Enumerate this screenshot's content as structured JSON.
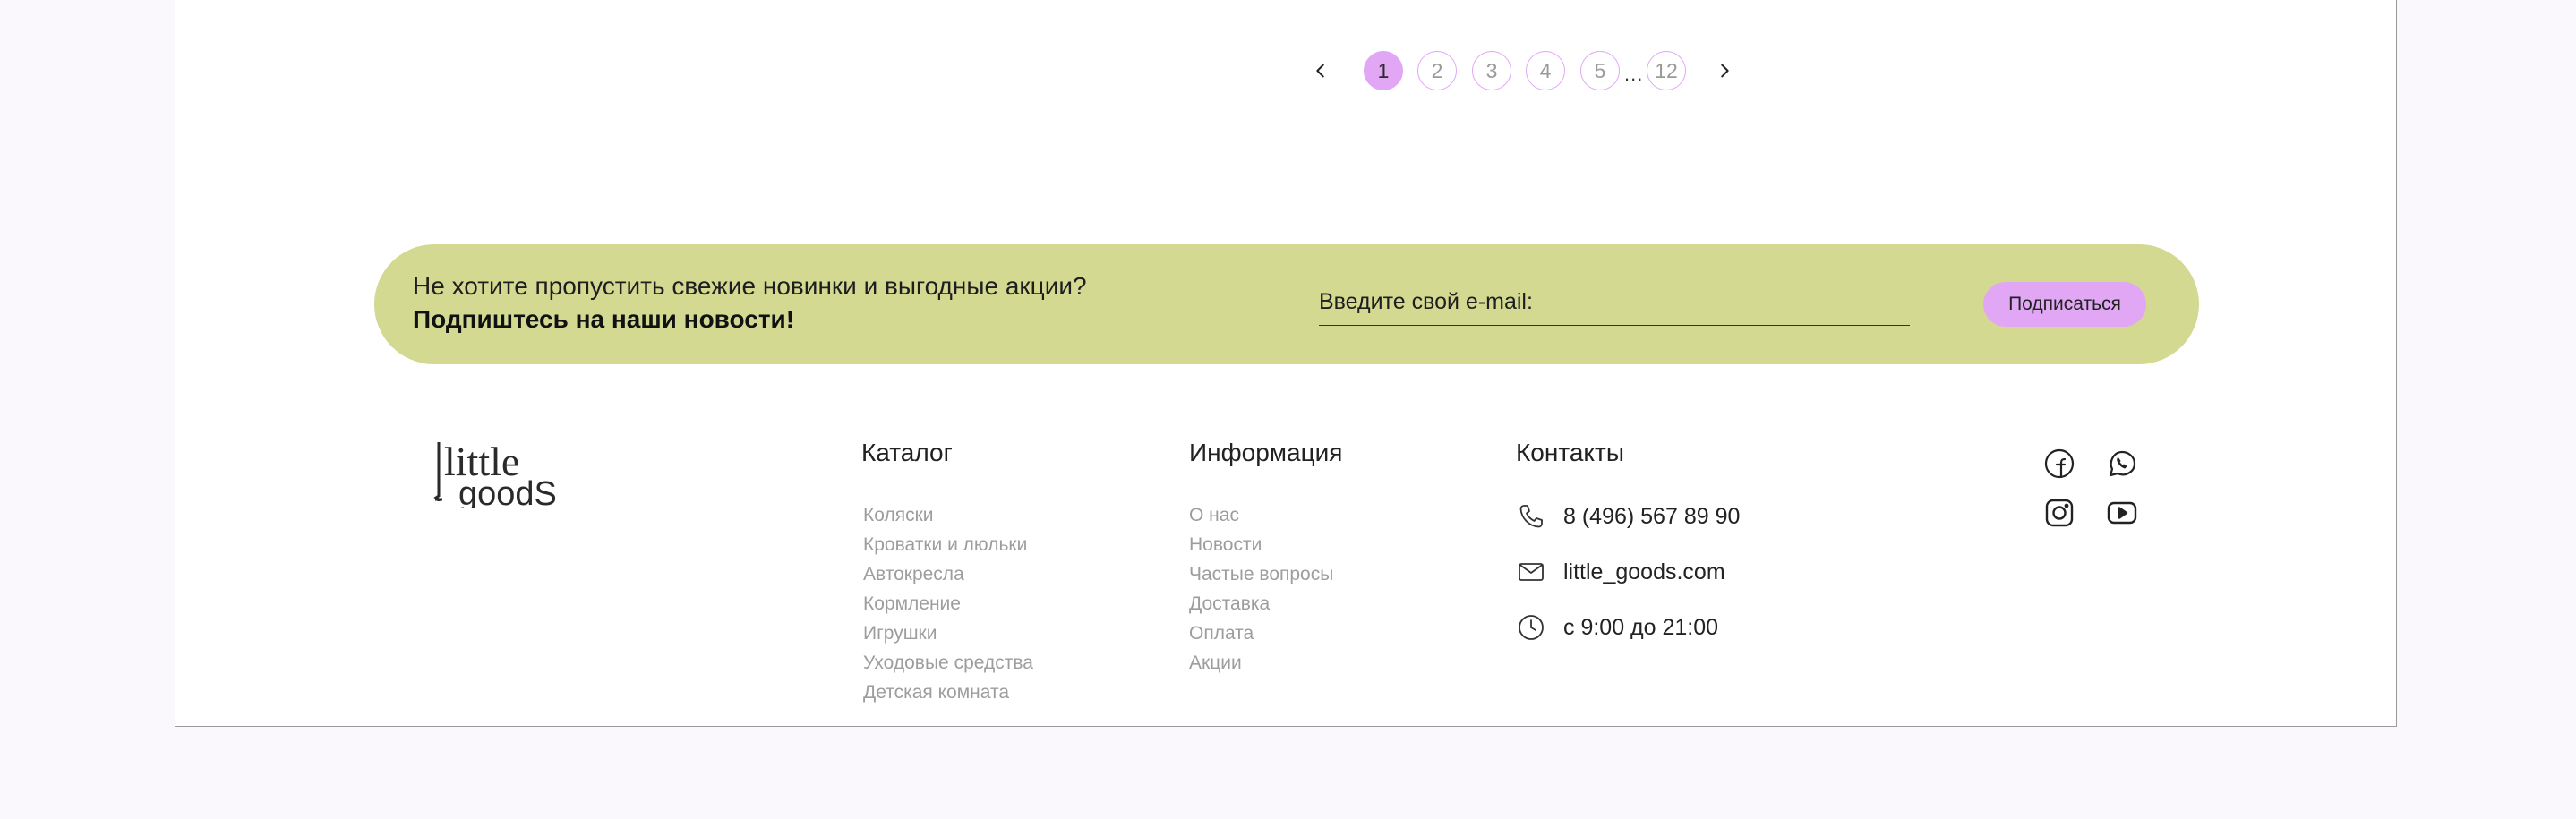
{
  "pagination": {
    "prev_icon": "chevron-left-icon",
    "next_icon": "chevron-right-icon",
    "pages": [
      "1",
      "2",
      "3",
      "4",
      "5"
    ],
    "ellipsis": "...",
    "last_page": "12",
    "current_page": "1"
  },
  "subscribe": {
    "line1": "Не хотите пропустить свежие новинки и выгодные акции?",
    "line2": "Подпиштесь на наши новости!",
    "email_placeholder": "Введите свой e-mail:",
    "button_label": "Подписаться",
    "background_color": "#d3d991",
    "accent_color": "#e1a7f5"
  },
  "logo": {
    "word1": "little",
    "word2": "goodS"
  },
  "footer": {
    "catalog": {
      "title": "Каталог",
      "items": [
        "Коляски",
        "Кроватки и люльки",
        "Автокресла",
        "Кормление",
        "Игрушки",
        "Уходовые средства",
        "Детская комната"
      ]
    },
    "info": {
      "title": "Информация",
      "items": [
        "О нас",
        "Новости",
        "Частые вопросы",
        "Доставка",
        "Оплата",
        "Акции"
      ]
    },
    "contacts": {
      "title": "Контакты",
      "phone": "8 (496) 567 89 90",
      "email": "little_goods.com",
      "hours": "с 9:00 до 21:00",
      "icons": [
        "phone-icon",
        "mail-icon",
        "clock-icon"
      ]
    },
    "social": [
      "facebook-icon",
      "whatsapp-icon",
      "instagram-icon",
      "youtube-icon"
    ]
  }
}
